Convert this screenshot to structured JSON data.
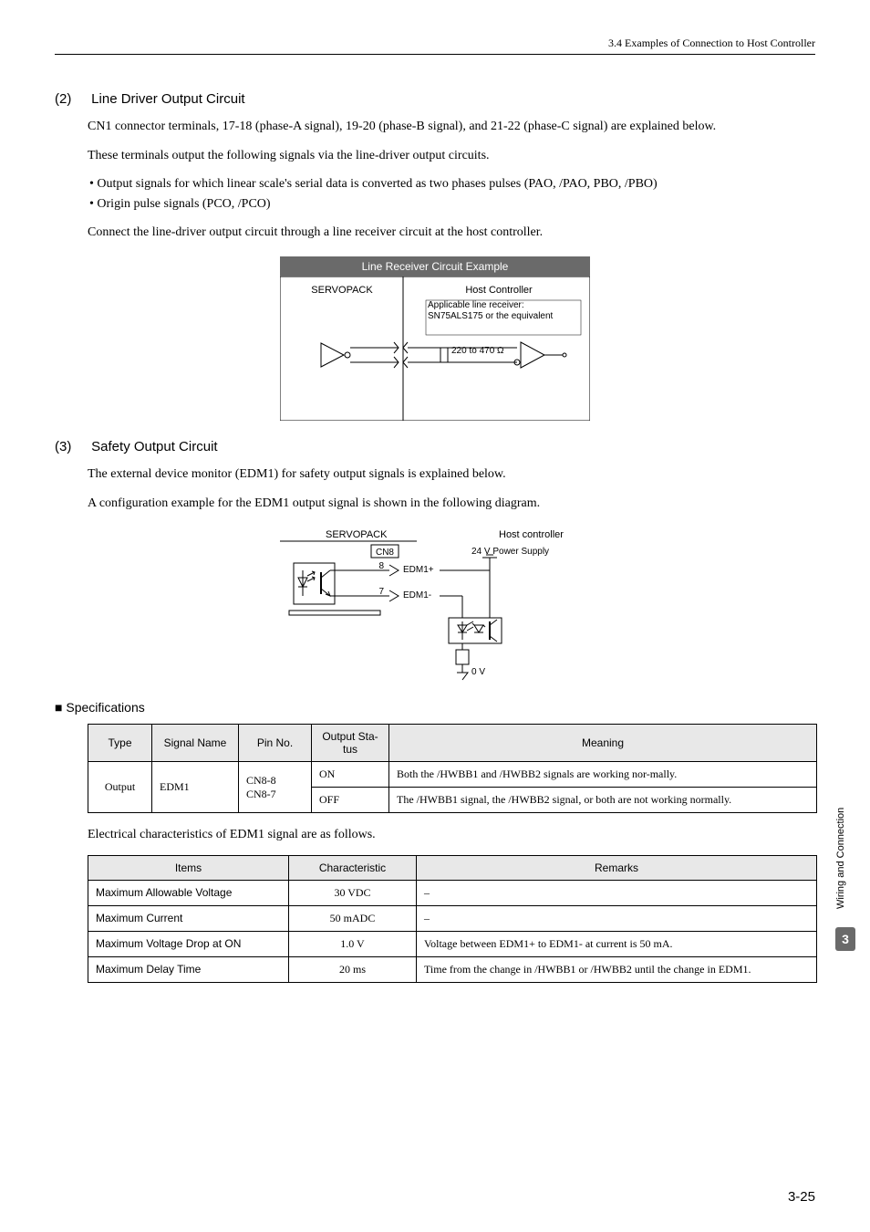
{
  "header": {
    "breadcrumb": "3.4  Examples of Connection to Host Controller"
  },
  "s2": {
    "num": "(2)",
    "title": "Line Driver Output Circuit",
    "p1": "CN1 connector terminals, 17-18 (phase-A signal), 19-20 (phase-B signal), and 21-22 (phase-C signal) are explained below.",
    "p2": "These terminals output the following signals via the line-driver output circuits.",
    "b1": "• Output signals for which linear scale's serial data is converted as two phases pulses (PAO, /PAO, PBO, /PBO)",
    "b2": "• Origin pulse signals (PCO, /PCO)",
    "p3": "Connect the line-driver output circuit through a line receiver circuit at the host controller.",
    "diag": {
      "title": "Line Receiver Circuit Example",
      "servopack": "SERVOPACK",
      "host": "Host Controller",
      "note": "Applicable line receiver: SN75ALS175 or the equivalent",
      "res": "220 to 470 Ω"
    }
  },
  "s3": {
    "num": "(3)",
    "title": "Safety Output Circuit",
    "p1": "The external device monitor (EDM1) for safety output signals is explained below.",
    "p2": "A configuration example for the EDM1 output signal is shown in the following diagram.",
    "diag": {
      "servopack": "SERVOPACK",
      "host": "Host controller",
      "cn8": "CN8",
      "pin8": "8",
      "pin7": "7",
      "edm1p": "EDM1+",
      "edm1m": "EDM1-",
      "psu": "24 V Power Supply",
      "zero": "0 V"
    }
  },
  "spec": {
    "heading": "Specifications",
    "t1": {
      "h1": "Type",
      "h2": "Signal Name",
      "h3": "Pin No.",
      "h4": "Output Sta-tus",
      "h5": "Meaning",
      "r_type": "Output",
      "r_sig": "EDM1",
      "r_pin": "CN8-8\nCN8-7",
      "r1_stat": "ON",
      "r1_mean": "Both the /HWBB1 and /HWBB2 signals are working nor-mally.",
      "r2_stat": "OFF",
      "r2_mean": "The /HWBB1 signal, the /HWBB2 signal, or both are not working normally."
    },
    "p1": "Electrical characteristics of EDM1 signal are as follows.",
    "t2": {
      "h1": "Items",
      "h2": "Characteristic",
      "h3": "Remarks",
      "r1_i": "Maximum Allowable Voltage",
      "r1_c": "30 VDC",
      "r1_r": "–",
      "r2_i": "Maximum Current",
      "r2_c": "50 mADC",
      "r2_r": "–",
      "r3_i": "Maximum Voltage Drop at ON",
      "r3_c": "1.0 V",
      "r3_r": "Voltage between EDM1+ to EDM1- at current is 50 mA.",
      "r4_i": "Maximum Delay Time",
      "r4_c": "20 ms",
      "r4_r": "Time from the change in /HWBB1 or /HWBB2 until the change in EDM1."
    }
  },
  "side": {
    "label": "Wiring and Connection",
    "chapter": "3"
  },
  "page": "3-25"
}
